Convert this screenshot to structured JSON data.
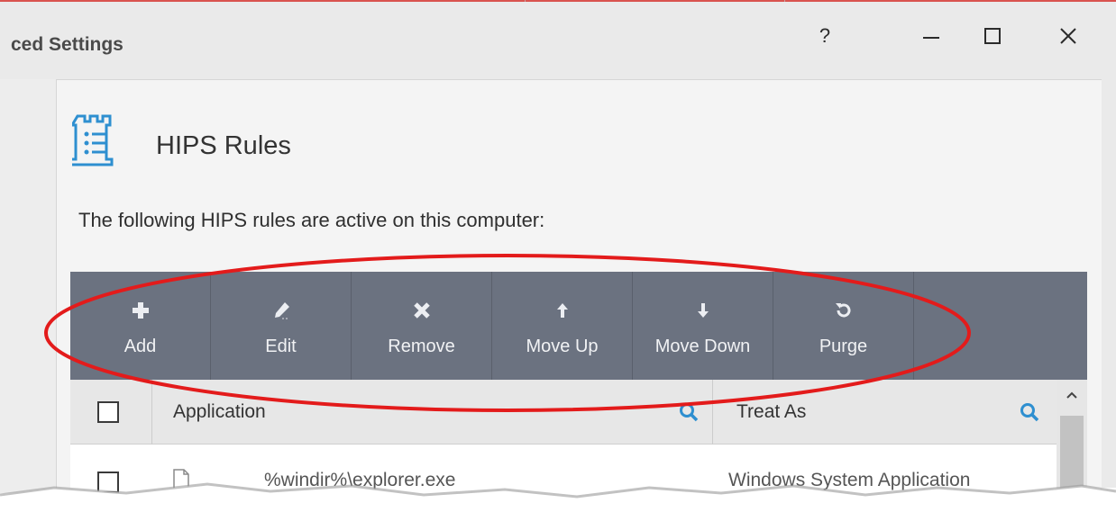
{
  "window": {
    "title": "ced Settings",
    "controls": {
      "help": "?"
    }
  },
  "section": {
    "icon": "rules-list-icon",
    "title": "HIPS Rules",
    "description": "The following HIPS rules are active on this computer:"
  },
  "toolbar": {
    "buttons": [
      {
        "label": "Add",
        "icon": "plus-icon"
      },
      {
        "label": "Edit",
        "icon": "pencil-icon"
      },
      {
        "label": "Remove",
        "icon": "x-icon"
      },
      {
        "label": "Move Up",
        "icon": "arrow-up-icon"
      },
      {
        "label": "Move Down",
        "icon": "arrow-down-icon"
      },
      {
        "label": "Purge",
        "icon": "refresh-icon"
      }
    ]
  },
  "table": {
    "columns": [
      "Application",
      "Treat As"
    ],
    "rows": [
      {
        "application": "%windir%\\explorer.exe",
        "treat_as": "Windows System Application"
      }
    ]
  },
  "colors": {
    "toolbar_bg": "#6b7280",
    "accent_blue": "#2e8fd0",
    "annotation_red": "#e31b1b"
  }
}
